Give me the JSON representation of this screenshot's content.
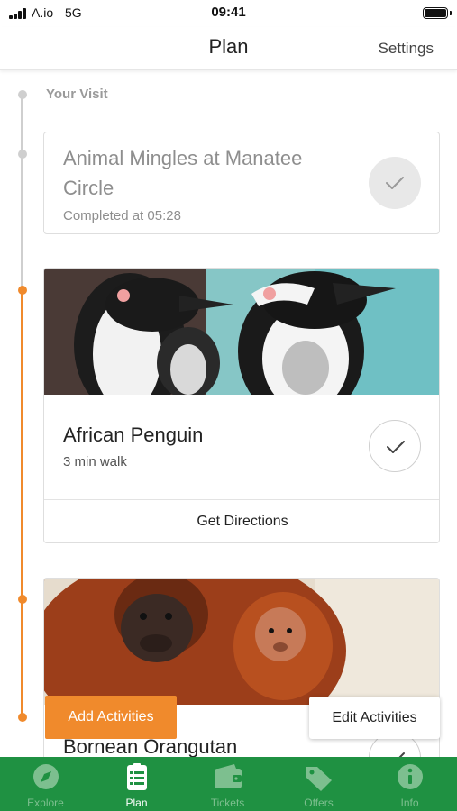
{
  "status_bar": {
    "carrier": "A.io",
    "network": "5G",
    "time": "09:41"
  },
  "header": {
    "title": "Plan",
    "settings_label": "Settings"
  },
  "timeline": {
    "section_label": "Your Visit"
  },
  "activities": [
    {
      "name": "Animal Mingles at Manatee Circle",
      "status": "Completed at 05:28",
      "completed": true,
      "check_icon": "checkmark-icon"
    },
    {
      "name": "African Penguin",
      "walk_time": "3 min walk",
      "directions_label": "Get Directions",
      "completed": false,
      "image": "african-penguin-photo",
      "check_icon": "checkmark-icon"
    },
    {
      "name": "Bornean Orangutan",
      "completed": false,
      "image": "bornean-orangutan-photo",
      "check_icon": "checkmark-icon"
    }
  ],
  "actions": {
    "add_label": "Add Activities",
    "edit_label": "Edit Activities"
  },
  "tab_bar": {
    "active": "Plan",
    "tabs": [
      {
        "label": "Explore",
        "icon": "compass-icon"
      },
      {
        "label": "Plan",
        "icon": "checklist-icon"
      },
      {
        "label": "Tickets",
        "icon": "wallet-icon"
      },
      {
        "label": "Offers",
        "icon": "tag-icon"
      },
      {
        "label": "Info",
        "icon": "info-icon"
      }
    ]
  },
  "colors": {
    "accent": "#f08a2c",
    "tab_bar": "#1f9142",
    "tab_inactive": "#7dbf8f",
    "timeline_done": "#cfcfcf"
  }
}
